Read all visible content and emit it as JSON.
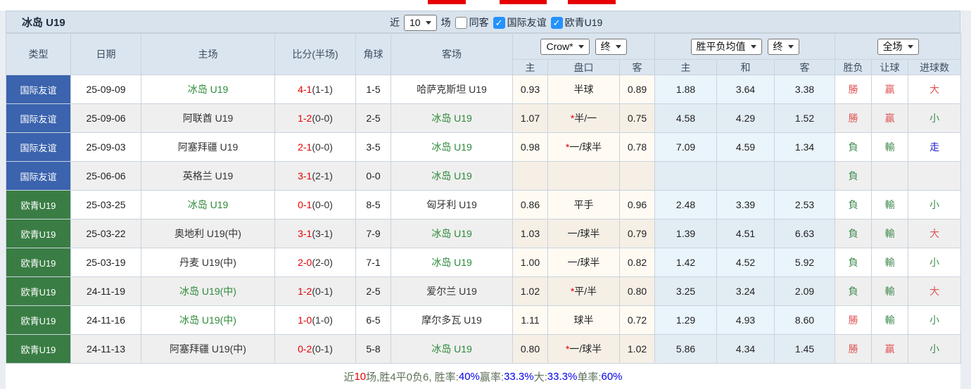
{
  "colors": {
    "type_blue": "#3b63ae",
    "type_green": "#3a7d44",
    "team_green": "#2e8b3a",
    "score_red": "#e60000",
    "win_red": "#e05555",
    "loss_green": "#3f8a4f",
    "draw_blue": "#2222cc",
    "header_bg": "#dbe5ef",
    "checkbox_blue": "#2492ff"
  },
  "top_bar": {
    "title": "冰岛 U19"
  },
  "filters": {
    "recent_label": "近",
    "recent_value": "10",
    "matches_label": "场",
    "same_away_label": "同客",
    "same_away_checked": false,
    "friendly_label": "国际友谊",
    "friendly_checked": true,
    "euro_label": "欧青U19",
    "euro_checked": true
  },
  "table": {
    "left_headers": [
      "类型",
      "日期",
      "主场",
      "比分(半场)",
      "角球",
      "客场"
    ],
    "selects": {
      "asian": "Crow*",
      "asian_final": "终",
      "euro": "胜平负均值",
      "euro_final": "终",
      "fullmatch": "全场"
    },
    "sub_headers": [
      "主",
      "盘口",
      "客",
      "主",
      "和",
      "客",
      "胜负",
      "让球",
      "进球数"
    ],
    "rows": [
      {
        "type": "国际友谊",
        "type_color": "blue",
        "date": "25-09-09",
        "home": "冰岛 U19",
        "home_green": true,
        "score_ft": "4-1",
        "score_ht": "(1-1)",
        "corner": "1-5",
        "away": "哈萨克斯坦 U19",
        "away_green": false,
        "odds_home": "0.93",
        "handicap_star": "",
        "handicap": "半球",
        "odds_away": "0.89",
        "euro_home": "1.88",
        "euro_draw": "3.64",
        "euro_away": "3.38",
        "res_wl": "勝",
        "res_wl_c": "red",
        "res_let": "赢",
        "res_let_c": "red",
        "res_goal": "大",
        "res_goal_c": "red"
      },
      {
        "type": "国际友谊",
        "type_color": "blue",
        "date": "25-09-06",
        "home": "阿联酋 U19",
        "home_green": false,
        "score_ft": "1-2",
        "score_ht": "(0-0)",
        "corner": "2-5",
        "away": "冰岛 U19",
        "away_green": true,
        "odds_home": "1.07",
        "handicap_star": "*",
        "handicap": "半/一",
        "odds_away": "0.75",
        "euro_home": "4.58",
        "euro_draw": "4.29",
        "euro_away": "1.52",
        "res_wl": "勝",
        "res_wl_c": "red",
        "res_let": "赢",
        "res_let_c": "red",
        "res_goal": "小",
        "res_goal_c": "green"
      },
      {
        "type": "国际友谊",
        "type_color": "blue",
        "date": "25-09-03",
        "home": "阿塞拜疆 U19",
        "home_green": false,
        "score_ft": "2-1",
        "score_ht": "(0-0)",
        "corner": "3-5",
        "away": "冰岛 U19",
        "away_green": true,
        "odds_home": "0.98",
        "handicap_star": "*",
        "handicap": "一/球半",
        "odds_away": "0.78",
        "euro_home": "7.09",
        "euro_draw": "4.59",
        "euro_away": "1.34",
        "res_wl": "負",
        "res_wl_c": "green",
        "res_let": "輸",
        "res_let_c": "green",
        "res_goal": "走",
        "res_goal_c": "blue"
      },
      {
        "type": "国际友谊",
        "type_color": "blue",
        "date": "25-06-06",
        "home": "英格兰 U19",
        "home_green": false,
        "score_ft": "3-1",
        "score_ht": "(2-1)",
        "corner": "0-0",
        "away": "冰岛 U19",
        "away_green": true,
        "odds_home": "",
        "handicap_star": "",
        "handicap": "",
        "odds_away": "",
        "euro_home": "",
        "euro_draw": "",
        "euro_away": "",
        "res_wl": "負",
        "res_wl_c": "green",
        "res_let": "",
        "res_let_c": "green",
        "res_goal": "",
        "res_goal_c": "green"
      },
      {
        "type": "欧青U19",
        "type_color": "green",
        "date": "25-03-25",
        "home": "冰岛 U19",
        "home_green": true,
        "score_ft": "0-1",
        "score_ht": "(0-0)",
        "corner": "8-5",
        "away": "匈牙利 U19",
        "away_green": false,
        "odds_home": "0.86",
        "handicap_star": "",
        "handicap": "平手",
        "odds_away": "0.96",
        "euro_home": "2.48",
        "euro_draw": "3.39",
        "euro_away": "2.53",
        "res_wl": "負",
        "res_wl_c": "green",
        "res_let": "輸",
        "res_let_c": "green",
        "res_goal": "小",
        "res_goal_c": "green"
      },
      {
        "type": "欧青U19",
        "type_color": "green",
        "date": "25-03-22",
        "home": "奥地利 U19(中)",
        "home_green": false,
        "score_ft": "3-1",
        "score_ht": "(3-1)",
        "corner": "7-9",
        "away": "冰岛 U19",
        "away_green": true,
        "odds_home": "1.03",
        "handicap_star": "",
        "handicap": "一/球半",
        "odds_away": "0.79",
        "euro_home": "1.39",
        "euro_draw": "4.51",
        "euro_away": "6.63",
        "res_wl": "負",
        "res_wl_c": "green",
        "res_let": "輸",
        "res_let_c": "green",
        "res_goal": "大",
        "res_goal_c": "red"
      },
      {
        "type": "欧青U19",
        "type_color": "green",
        "date": "25-03-19",
        "home": "丹麦 U19(中)",
        "home_green": false,
        "score_ft": "2-0",
        "score_ht": "(2-0)",
        "corner": "7-1",
        "away": "冰岛 U19",
        "away_green": true,
        "odds_home": "1.00",
        "handicap_star": "",
        "handicap": "一/球半",
        "odds_away": "0.82",
        "euro_home": "1.42",
        "euro_draw": "4.52",
        "euro_away": "5.92",
        "res_wl": "負",
        "res_wl_c": "green",
        "res_let": "輸",
        "res_let_c": "green",
        "res_goal": "小",
        "res_goal_c": "green"
      },
      {
        "type": "欧青U19",
        "type_color": "green",
        "date": "24-11-19",
        "home": "冰岛 U19(中)",
        "home_green": true,
        "score_ft": "1-2",
        "score_ht": "(0-1)",
        "corner": "2-5",
        "away": "爱尔兰 U19",
        "away_green": false,
        "odds_home": "1.02",
        "handicap_star": "*",
        "handicap": "平/半",
        "odds_away": "0.80",
        "euro_home": "3.25",
        "euro_draw": "3.24",
        "euro_away": "2.09",
        "res_wl": "負",
        "res_wl_c": "green",
        "res_let": "輸",
        "res_let_c": "green",
        "res_goal": "大",
        "res_goal_c": "red"
      },
      {
        "type": "欧青U19",
        "type_color": "green",
        "date": "24-11-16",
        "home": "冰岛 U19(中)",
        "home_green": true,
        "score_ft": "1-0",
        "score_ht": "(1-0)",
        "corner": "6-5",
        "away": "摩尔多瓦 U19",
        "away_green": false,
        "odds_home": "1.11",
        "handicap_star": "",
        "handicap": "球半",
        "odds_away": "0.72",
        "euro_home": "1.29",
        "euro_draw": "4.93",
        "euro_away": "8.60",
        "res_wl": "勝",
        "res_wl_c": "red",
        "res_let": "輸",
        "res_let_c": "green",
        "res_goal": "小",
        "res_goal_c": "green"
      },
      {
        "type": "欧青U19",
        "type_color": "green",
        "date": "24-11-13",
        "home": "阿塞拜疆 U19(中)",
        "home_green": false,
        "score_ft": "0-2",
        "score_ht": "(0-1)",
        "corner": "5-8",
        "away": "冰岛 U19",
        "away_green": true,
        "odds_home": "0.80",
        "handicap_star": "*",
        "handicap": "一/球半",
        "odds_away": "1.02",
        "euro_home": "5.86",
        "euro_draw": "4.34",
        "euro_away": "1.45",
        "res_wl": "勝",
        "res_wl_c": "red",
        "res_let": "赢",
        "res_let_c": "red",
        "res_goal": "小",
        "res_goal_c": "green"
      }
    ]
  },
  "summary": {
    "segments": [
      {
        "text": "近",
        "color": "label"
      },
      {
        "text": "10",
        "color": "red"
      },
      {
        "text": "场,胜4平0负6, 胜率:",
        "color": "label"
      },
      {
        "text": "40%",
        "color": "blue"
      },
      {
        "text": " 赢率:",
        "color": "label"
      },
      {
        "text": "33.3%",
        "color": "blue"
      },
      {
        "text": " 大:",
        "color": "label"
      },
      {
        "text": "33.3%",
        "color": "blue"
      },
      {
        "text": " 单率:",
        "color": "label"
      },
      {
        "text": "60%",
        "color": "blue"
      }
    ]
  }
}
